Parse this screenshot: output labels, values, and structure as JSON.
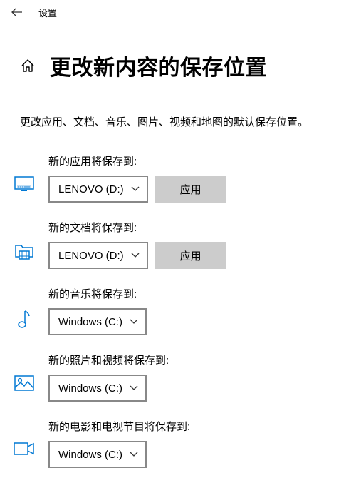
{
  "window": {
    "title": "设置"
  },
  "page": {
    "title": "更改新内容的保存位置",
    "description": "更改应用、文档、音乐、图片、视频和地图的默认保存位置。"
  },
  "common": {
    "apply_label": "应用"
  },
  "settings": {
    "apps": {
      "label": "新的应用将保存到:",
      "value": "LENOVO (D:)",
      "showApply": true
    },
    "documents": {
      "label": "新的文档将保存到:",
      "value": "LENOVO (D:)",
      "showApply": true
    },
    "music": {
      "label": "新的音乐将保存到:",
      "value": "Windows (C:)",
      "showApply": false
    },
    "photos": {
      "label": "新的照片和视频将保存到:",
      "value": "Windows (C:)",
      "showApply": false
    },
    "movies": {
      "label": "新的电影和电视节目将保存到:",
      "value": "Windows (C:)",
      "showApply": false
    }
  }
}
